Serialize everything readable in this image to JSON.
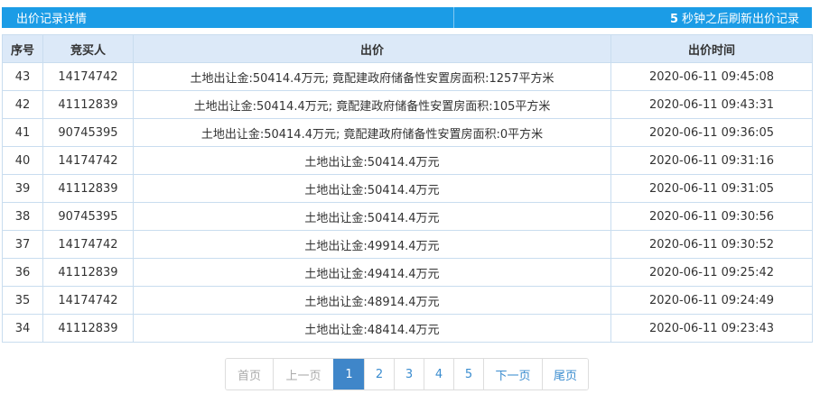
{
  "header": {
    "title": "出价记录详情",
    "refresh_seconds": "5",
    "refresh_text": "秒钟之后刷新出价记录"
  },
  "table": {
    "columns": [
      "序号",
      "竞买人",
      "出价",
      "出价时间"
    ],
    "rows": [
      [
        "43",
        "14174742",
        "土地出让金:50414.4万元; 竟配建政府储备性安置房面积:1257平方米",
        "2020-06-11 09:45:08"
      ],
      [
        "42",
        "41112839",
        "土地出让金:50414.4万元; 竟配建政府储备性安置房面积:105平方米",
        "2020-06-11 09:43:31"
      ],
      [
        "41",
        "90745395",
        "土地出让金:50414.4万元; 竟配建政府储备性安置房面积:0平方米",
        "2020-06-11 09:36:05"
      ],
      [
        "40",
        "14174742",
        "土地出让金:50414.4万元",
        "2020-06-11 09:31:16"
      ],
      [
        "39",
        "41112839",
        "土地出让金:50414.4万元",
        "2020-06-11 09:31:05"
      ],
      [
        "38",
        "90745395",
        "土地出让金:50414.4万元",
        "2020-06-11 09:30:56"
      ],
      [
        "37",
        "14174742",
        "土地出让金:49914.4万元",
        "2020-06-11 09:30:52"
      ],
      [
        "36",
        "41112839",
        "土地出让金:49414.4万元",
        "2020-06-11 09:25:42"
      ],
      [
        "35",
        "14174742",
        "土地出让金:48914.4万元",
        "2020-06-11 09:24:49"
      ],
      [
        "34",
        "41112839",
        "土地出让金:48414.4万元",
        "2020-06-11 09:23:43"
      ]
    ]
  },
  "pager": {
    "first": "首页",
    "prev": "上一页",
    "pages": [
      "1",
      "2",
      "3",
      "4",
      "5"
    ],
    "current": "1",
    "next": "下一页",
    "last": "尾页"
  },
  "colors": {
    "header_bg": "#1b9ce6",
    "table_head_bg": "#dce9f8",
    "pager_active": "#3f86c9"
  }
}
